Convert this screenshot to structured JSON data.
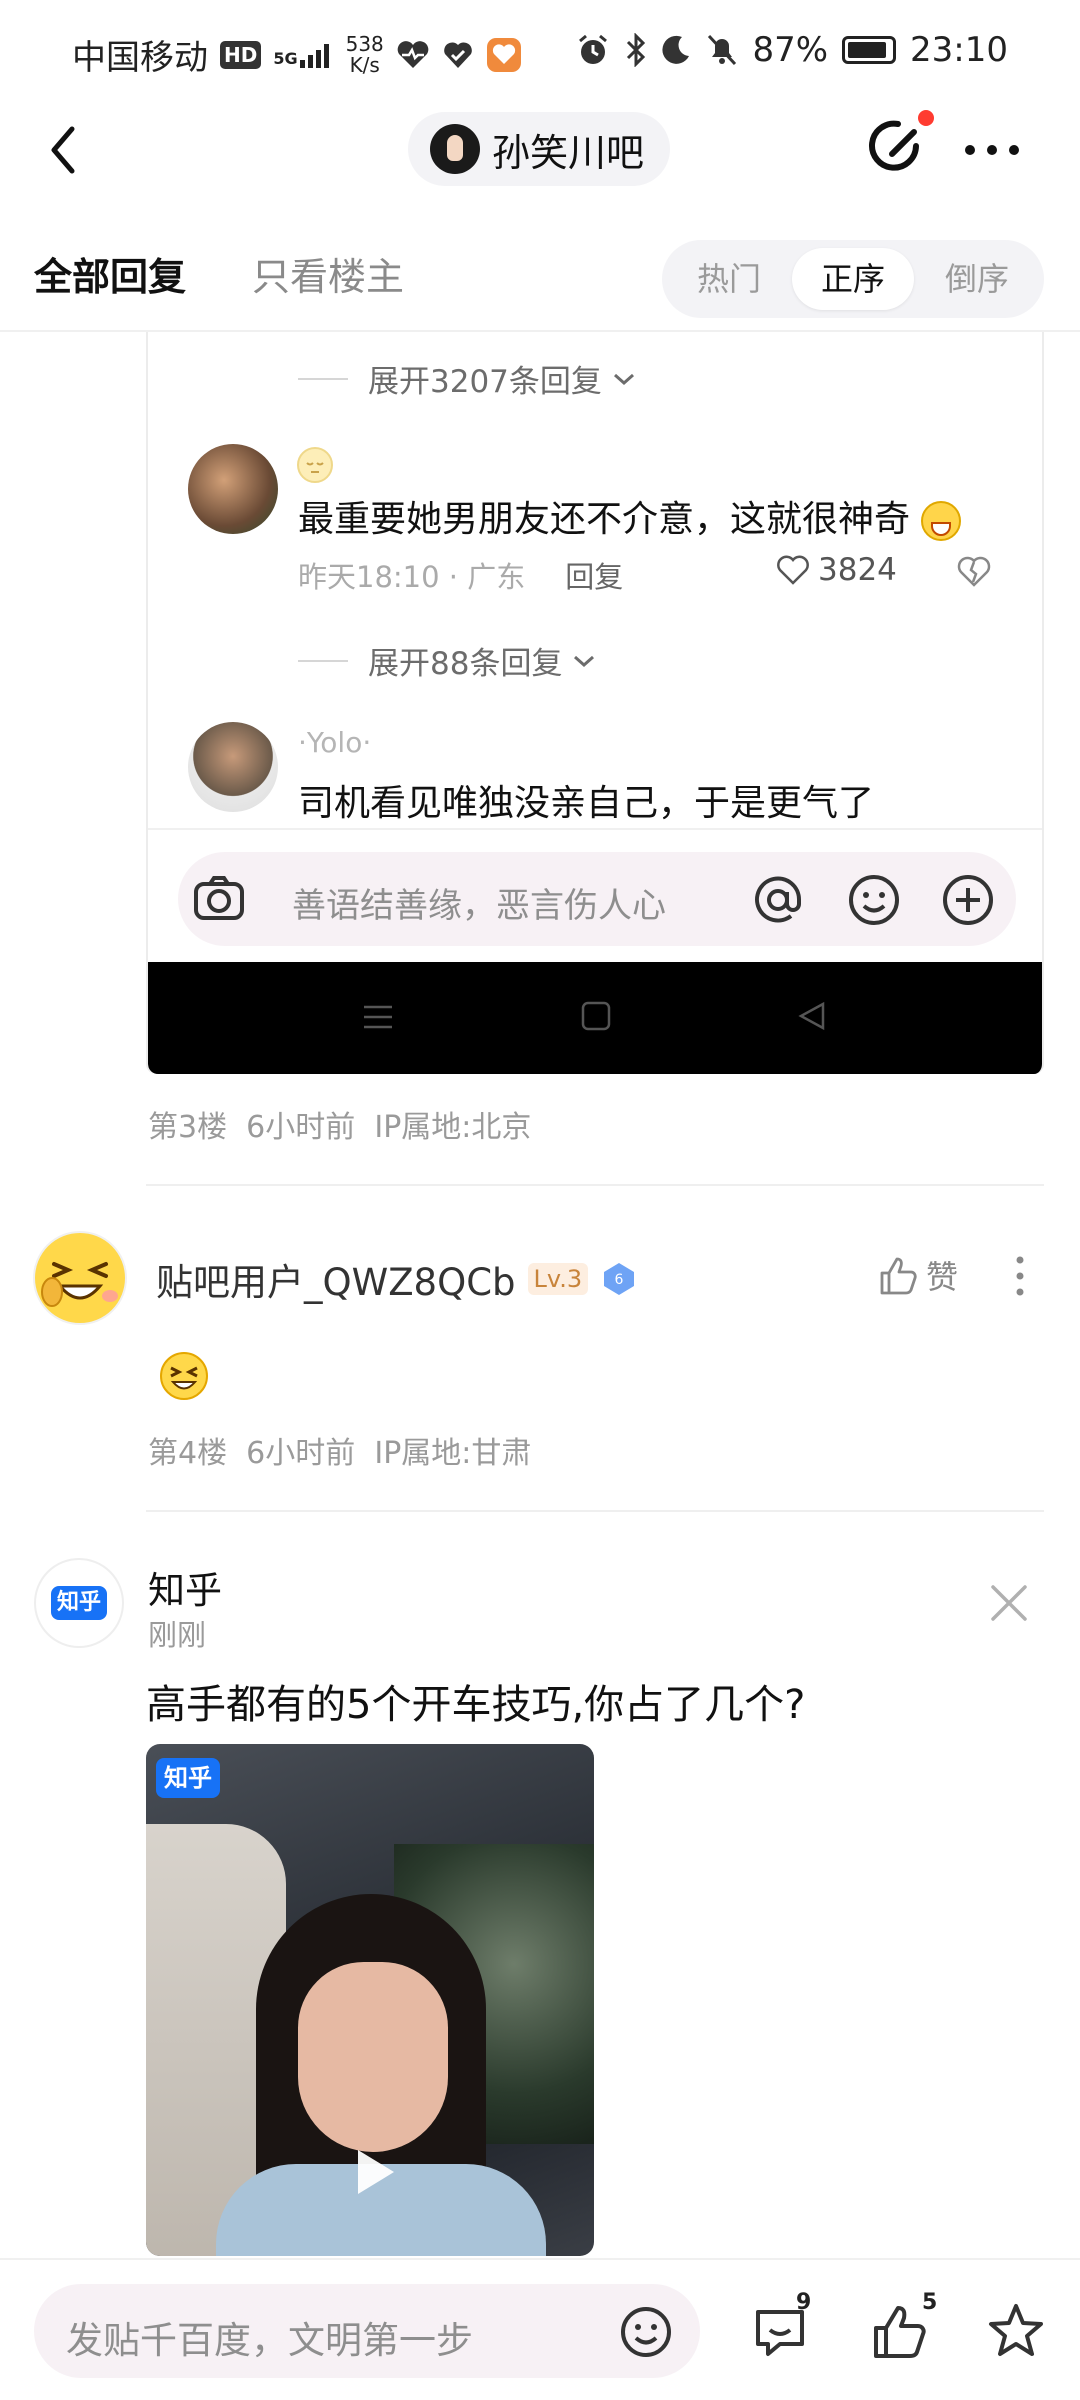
{
  "status_bar": {
    "carrier": "中国移动",
    "hd": "HD",
    "signal": "5G",
    "speed_value": "538",
    "speed_unit": "K/s",
    "battery": "87%",
    "time": "23:10"
  },
  "header": {
    "forum_name": "孙笑川吧"
  },
  "tabs": {
    "all_replies": "全部回复",
    "op_only": "只看楼主",
    "sort": [
      "热门",
      "正序",
      "倒序"
    ],
    "active_sort": "正序"
  },
  "embedded": {
    "expand_1": "展开3207条回复",
    "comment_1": {
      "text": "最重要她男朋友还不介意，这就很神奇",
      "time_loc": "昨天18:10 · 广东",
      "reply": "回复",
      "likes": "3824"
    },
    "expand_2": "展开88条回复",
    "comment_2": {
      "user": "·Yolo·",
      "text": "司机看见唯独没亲自己，于是更气了"
    },
    "input_placeholder": "善语结善缘，恶言伤人心"
  },
  "floor3": {
    "floor": "第3楼",
    "time": "6小时前",
    "ip": "IP属地:北京"
  },
  "floor4": {
    "user": "贴吧用户_QWZ8QCb",
    "level": "Lv.3",
    "badge": "6",
    "like": "赞",
    "floor": "第4楼",
    "time": "6小时前",
    "ip": "IP属地:甘肃"
  },
  "ad": {
    "name": "知乎",
    "time": "刚刚",
    "title": "高手都有的5个开车技巧,你占了几个?",
    "badge": "知乎"
  },
  "bottom_bar": {
    "placeholder": "发贴千百度，文明第一步",
    "comment_count": "9",
    "like_count": "5"
  },
  "colors": {
    "accent_red": "#ff3b30",
    "zhihu_blue": "#1772f6",
    "muted": "#9a9a9a"
  },
  "icons": [
    "back-arrow-icon",
    "edit-icon",
    "more-icon",
    "camera-icon",
    "at-icon",
    "emoji-icon",
    "plus-icon",
    "heart-icon",
    "dislike-icon",
    "thumbs-up-icon",
    "close-icon",
    "play-icon",
    "comment-icon",
    "star-icon"
  ]
}
